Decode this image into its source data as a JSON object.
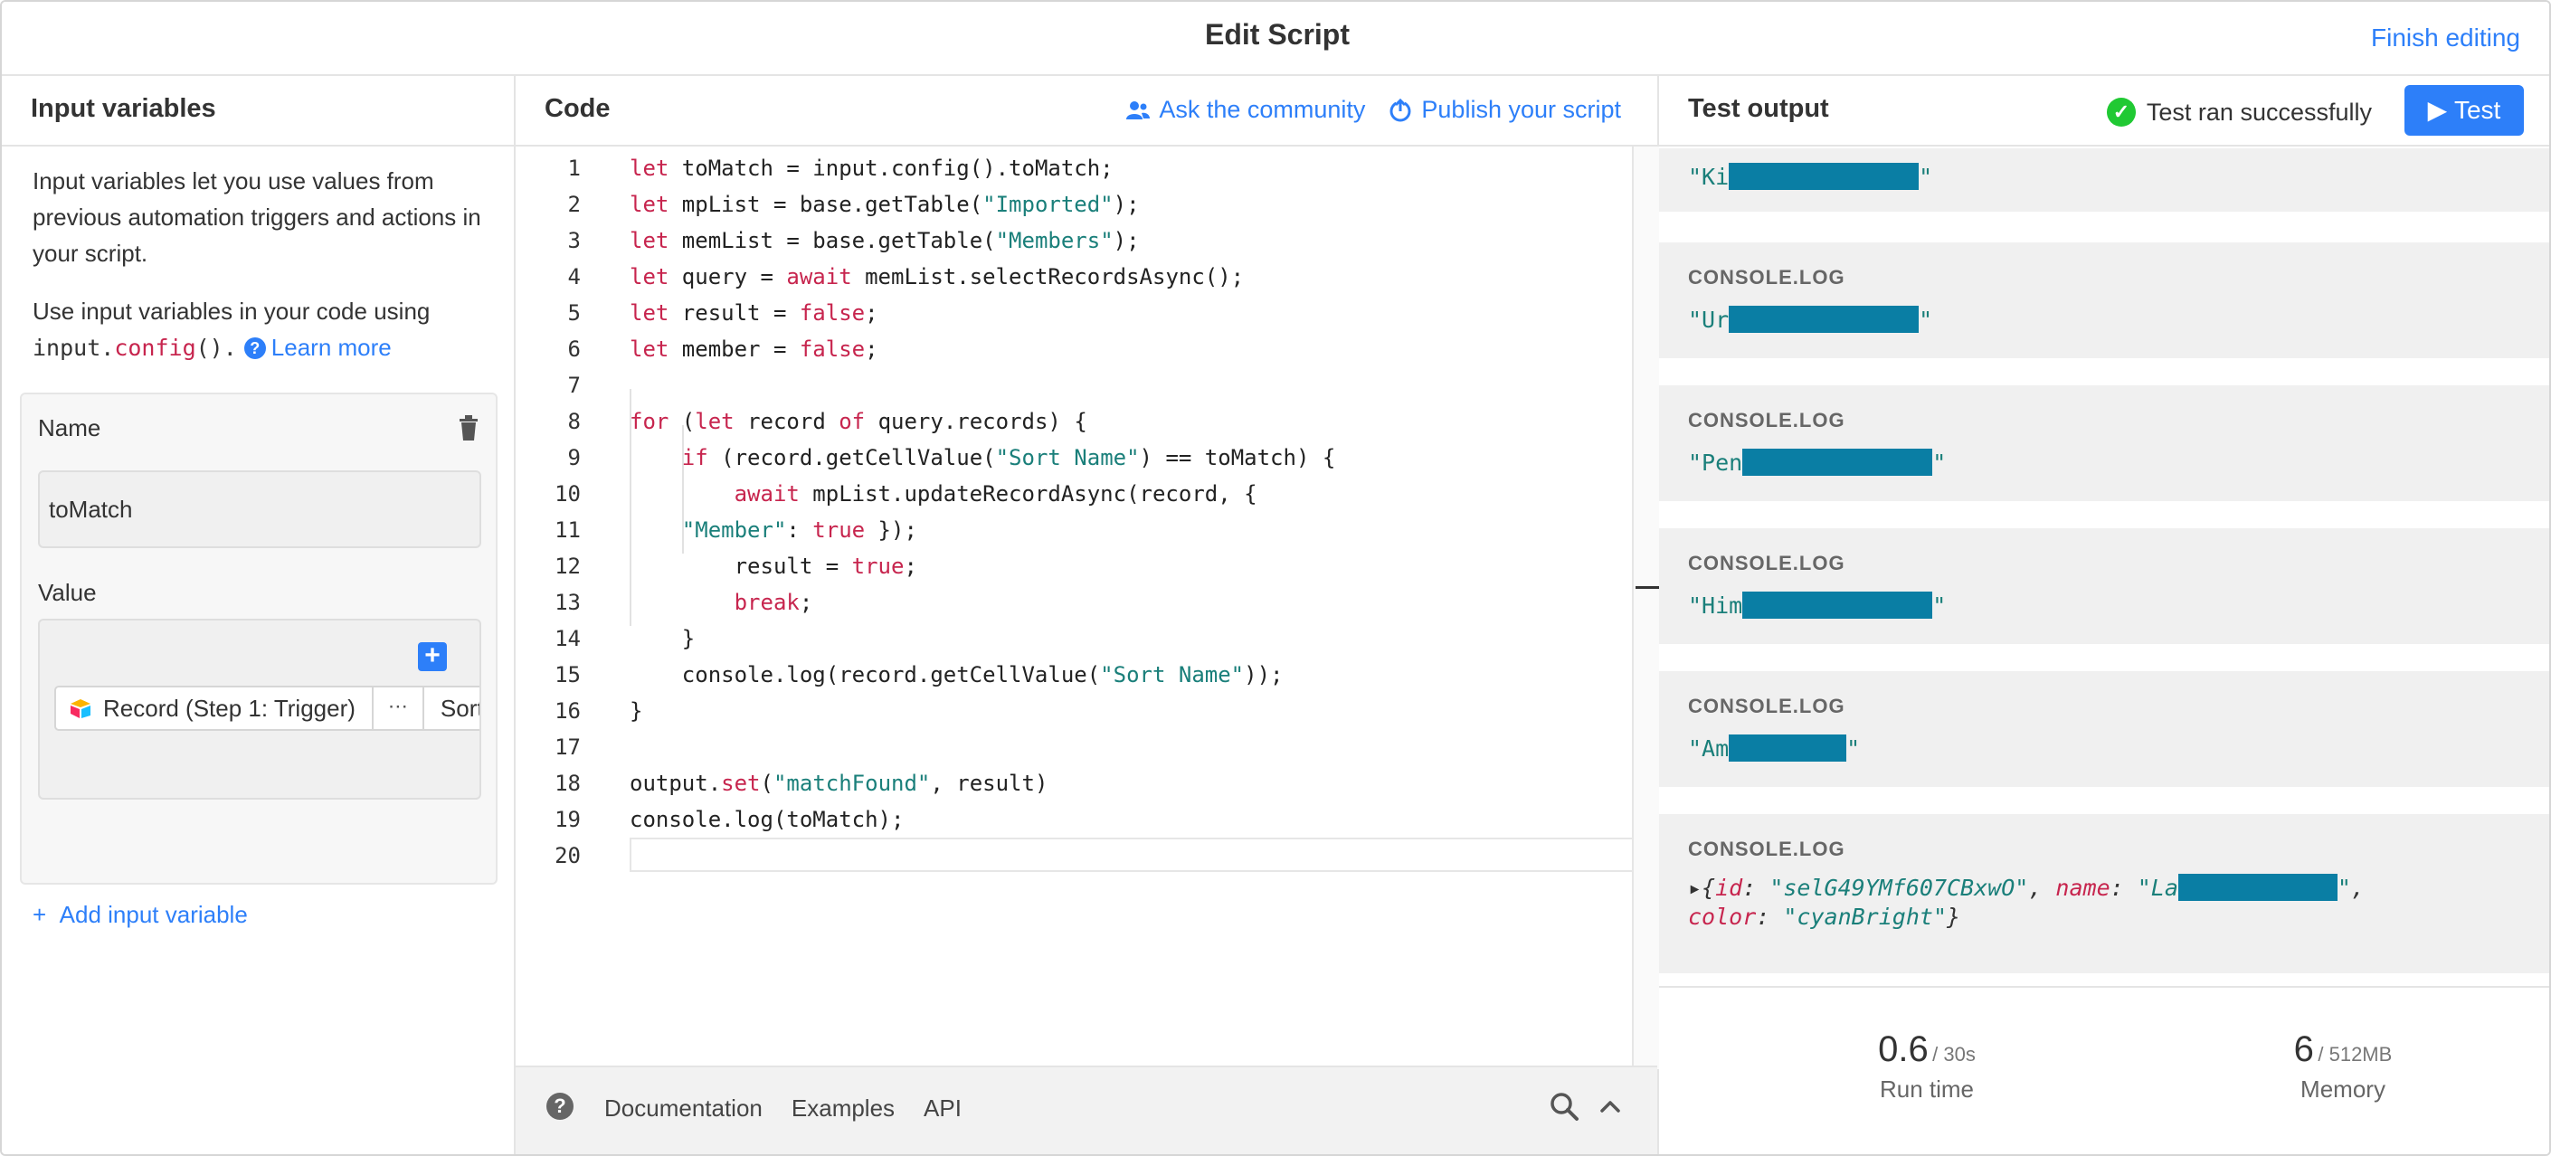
{
  "header": {
    "title": "Edit Script",
    "finish_label": "Finish editing"
  },
  "left": {
    "title": "Input variables",
    "intro": "Input variables let you use values from previous automation triggers and actions in your script.",
    "intro2_prefix": "Use input variables in your code using",
    "intro2_code_obj": "input.",
    "intro2_code_fn": "config",
    "intro2_code_end": "().",
    "learn_more": "Learn more",
    "var": {
      "name_label": "Name",
      "name_value": "toMatch",
      "value_label": "Value",
      "token_label": "Record (Step 1: Trigger)",
      "token_dots": "⋯",
      "token_field": "Sort Name"
    },
    "add_var_label": "Add input variable"
  },
  "middle": {
    "title": "Code",
    "ask_label": "Ask the community",
    "publish_label": "Publish your script",
    "footer": {
      "doc": "Documentation",
      "examples": "Examples",
      "api": "API"
    },
    "code": [
      [
        [
          "kw",
          "let"
        ],
        [
          "t",
          " toMatch = input.config().toMatch;"
        ]
      ],
      [
        [
          "kw",
          "let"
        ],
        [
          "t",
          " mpList = base.getTable("
        ],
        [
          "s",
          "\"Imported\""
        ],
        [
          "t",
          ");"
        ]
      ],
      [
        [
          "kw",
          "let"
        ],
        [
          "t",
          " memList = base.getTable("
        ],
        [
          "s",
          "\"Members\""
        ],
        [
          "t",
          ");"
        ]
      ],
      [
        [
          "kw",
          "let"
        ],
        [
          "t",
          " query = "
        ],
        [
          "kw",
          "await"
        ],
        [
          "t",
          " memList.selectRecordsAsync();"
        ]
      ],
      [
        [
          "kw",
          "let"
        ],
        [
          "t",
          " result = "
        ],
        [
          "kw",
          "false"
        ],
        [
          "t",
          ";"
        ]
      ],
      [
        [
          "kw",
          "let"
        ],
        [
          "t",
          " member = "
        ],
        [
          "kw",
          "false"
        ],
        [
          "t",
          ";"
        ]
      ],
      [],
      [
        [
          "kw",
          "for"
        ],
        [
          "t",
          " ("
        ],
        [
          "kw",
          "let"
        ],
        [
          "t",
          " record "
        ],
        [
          "kw",
          "of"
        ],
        [
          "t",
          " query.records) {"
        ]
      ],
      [
        [
          "t",
          "    "
        ],
        [
          "kw",
          "if"
        ],
        [
          "t",
          " (record.getCellValue("
        ],
        [
          "s",
          "\"Sort Name\""
        ],
        [
          "t",
          ") == toMatch) {"
        ]
      ],
      [
        [
          "t",
          "        "
        ],
        [
          "kw",
          "await"
        ],
        [
          "t",
          " mpList.updateRecordAsync(record, {"
        ]
      ],
      [
        [
          "t",
          "    "
        ],
        [
          "s",
          "\"Member\""
        ],
        [
          "t",
          ": "
        ],
        [
          "kw",
          "true"
        ],
        [
          "t",
          " });"
        ]
      ],
      [
        [
          "t",
          "        result = "
        ],
        [
          "kw",
          "true"
        ],
        [
          "t",
          ";"
        ]
      ],
      [
        [
          "t",
          "        "
        ],
        [
          "kw",
          "break"
        ],
        [
          "t",
          ";"
        ]
      ],
      [
        [
          "t",
          "    }"
        ]
      ],
      [
        [
          "t",
          "    console.log(record.getCellValue("
        ],
        [
          "s",
          "\"Sort Name\""
        ],
        [
          "t",
          "));"
        ]
      ],
      [
        [
          "t",
          "}"
        ]
      ],
      [],
      [
        [
          "t",
          "output."
        ],
        [
          "kw",
          "set"
        ],
        [
          "t",
          "("
        ],
        [
          "s",
          "\"matchFound\""
        ],
        [
          "t",
          ", result)"
        ]
      ],
      [
        [
          "t",
          "console.log(toMatch);"
        ]
      ],
      []
    ]
  },
  "right": {
    "title": "Test output",
    "status": "Test ran successfully",
    "test_label": "Test",
    "entries": [
      {
        "label": "",
        "prefix": "\"Ki",
        "suffix": "\""
      },
      {
        "label": "CONSOLE.LOG",
        "prefix": "\"Ur",
        "suffix": "\""
      },
      {
        "label": "CONSOLE.LOG",
        "prefix": "\"Pen",
        "suffix": "\""
      },
      {
        "label": "CONSOLE.LOG",
        "prefix": "\"Him",
        "suffix": "\""
      },
      {
        "label": "CONSOLE.LOG",
        "prefix": "\"Am",
        "suffix": "\""
      }
    ],
    "object_entry": {
      "label": "CONSOLE.LOG",
      "open": "▸{",
      "k_id": "id",
      "v_id": "\"selG49YMf607CBxwO\"",
      "k_name": "name",
      "v_name_prefix": "\"La",
      "v_name_suffix": "\"",
      "k_color": "color",
      "v_color": "\"cyanBright\"",
      "close": "}"
    },
    "metrics": {
      "runtime_value": "0.6",
      "runtime_unit": "/ 30s",
      "runtime_label": "Run time",
      "memory_value": "6",
      "memory_unit": "/ 512MB",
      "memory_label": "Memory"
    }
  },
  "colors": {
    "accent": "#2d7ff9",
    "success": "#20c933",
    "keyword": "#c7254e",
    "string": "#1a7f7a",
    "redaction": "#0a7ea4"
  }
}
